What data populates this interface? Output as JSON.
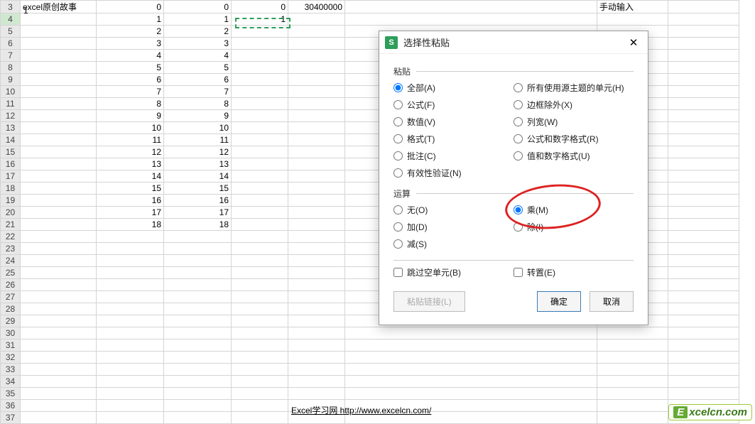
{
  "rows": [
    {
      "n": "3",
      "b": "excel原创故事",
      "c": "0",
      "d": "0",
      "e": "0",
      "f": "30400000",
      "h": "手动输入",
      "active": false
    },
    {
      "n": "4",
      "b": "",
      "c": "1",
      "d": "1",
      "e": "1",
      "f": "",
      "h": "",
      "active": true
    },
    {
      "n": "5",
      "b": "",
      "c": "2",
      "d": "2",
      "e": "",
      "f": "",
      "h": ""
    },
    {
      "n": "6",
      "b": "",
      "c": "3",
      "d": "3",
      "e": "",
      "f": "",
      "h": ""
    },
    {
      "n": "7",
      "b": "",
      "c": "4",
      "d": "4",
      "e": "",
      "f": "",
      "h": ""
    },
    {
      "n": "8",
      "b": "",
      "c": "5",
      "d": "5",
      "e": "",
      "f": "",
      "h": ""
    },
    {
      "n": "9",
      "b": "",
      "c": "6",
      "d": "6",
      "e": "",
      "f": "",
      "h": ""
    },
    {
      "n": "10",
      "b": "",
      "c": "7",
      "d": "7",
      "e": "",
      "f": "",
      "h": ""
    },
    {
      "n": "11",
      "b": "",
      "c": "8",
      "d": "8",
      "e": "",
      "f": "",
      "h": ""
    },
    {
      "n": "12",
      "b": "",
      "c": "9",
      "d": "9",
      "e": "",
      "f": "",
      "h": ""
    },
    {
      "n": "13",
      "b": "",
      "c": "10",
      "d": "10",
      "e": "",
      "f": "",
      "h": ""
    },
    {
      "n": "14",
      "b": "",
      "c": "11",
      "d": "11",
      "e": "",
      "f": "",
      "h": ""
    },
    {
      "n": "15",
      "b": "",
      "c": "12",
      "d": "12",
      "e": "",
      "f": "",
      "h": ""
    },
    {
      "n": "16",
      "b": "",
      "c": "13",
      "d": "13",
      "e": "",
      "f": "",
      "h": ""
    },
    {
      "n": "17",
      "b": "",
      "c": "14",
      "d": "14",
      "e": "",
      "f": "",
      "h": ""
    },
    {
      "n": "18",
      "b": "",
      "c": "15",
      "d": "15",
      "e": "",
      "f": "",
      "h": ""
    },
    {
      "n": "19",
      "b": "",
      "c": "16",
      "d": "16",
      "e": "",
      "f": "",
      "h": ""
    },
    {
      "n": "20",
      "b": "",
      "c": "17",
      "d": "17",
      "e": "",
      "f": "",
      "h": ""
    },
    {
      "n": "21",
      "b": "",
      "c": "18",
      "d": "18",
      "e": "",
      "f": "",
      "h": ""
    },
    {
      "n": "22"
    },
    {
      "n": "23"
    },
    {
      "n": "24"
    },
    {
      "n": "25"
    },
    {
      "n": "26"
    },
    {
      "n": "27"
    },
    {
      "n": "28"
    },
    {
      "n": "29"
    },
    {
      "n": "30"
    },
    {
      "n": "31"
    },
    {
      "n": "32"
    },
    {
      "n": "33"
    },
    {
      "n": "34"
    },
    {
      "n": "35"
    },
    {
      "n": "36"
    },
    {
      "n": "37"
    }
  ],
  "row3_prefix": "1",
  "dialog": {
    "title": "选择性粘贴",
    "icon": "S",
    "sections": {
      "paste": "粘贴",
      "operation": "运算"
    },
    "paste_options_left": [
      {
        "label": "全部(A)",
        "checked": true
      },
      {
        "label": "公式(F)",
        "checked": false
      },
      {
        "label": "数值(V)",
        "checked": false
      },
      {
        "label": "格式(T)",
        "checked": false
      },
      {
        "label": "批注(C)",
        "checked": false
      },
      {
        "label": "有效性验证(N)",
        "checked": false
      }
    ],
    "paste_options_right": [
      {
        "label": "所有使用源主题的单元(H)",
        "checked": false
      },
      {
        "label": "边框除外(X)",
        "checked": false
      },
      {
        "label": "列宽(W)",
        "checked": false
      },
      {
        "label": "公式和数字格式(R)",
        "checked": false
      },
      {
        "label": "值和数字格式(U)",
        "checked": false
      }
    ],
    "op_options_left": [
      {
        "label": "无(O)",
        "checked": false
      },
      {
        "label": "加(D)",
        "checked": false
      },
      {
        "label": "减(S)",
        "checked": false
      }
    ],
    "op_options_right": [
      {
        "label": "乘(M)",
        "checked": true
      },
      {
        "label": "除(I)",
        "checked": false
      }
    ],
    "skip_blanks": "跳过空单元(B)",
    "transpose": "转置(E)",
    "paste_link": "粘贴链接(L)",
    "ok": "确定",
    "cancel": "取消"
  },
  "footer": "Excel学习网 http://www.excelcn.com/",
  "watermark": {
    "e": "E",
    "rest": "xcelcn.com"
  }
}
